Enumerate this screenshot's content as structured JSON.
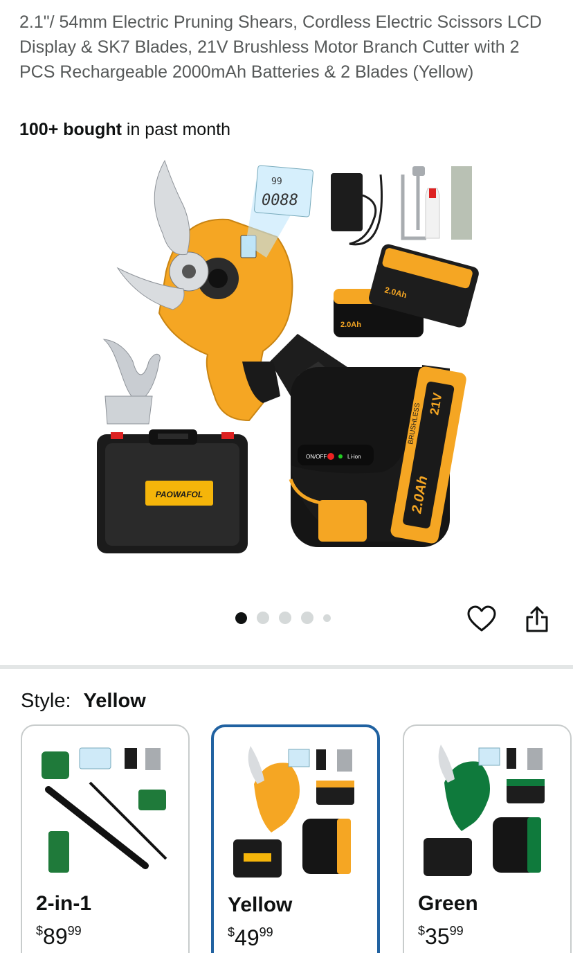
{
  "product": {
    "title": "2.1\"/ 54mm Electric Pruning Shears, Cordless Electric Scissors LCD Display & SK7 Blades, 21V Brushless Motor Branch Cutter with 2 PCS Rechargeable 2000mAh Batteries & 2 Blades (Yellow)",
    "bought_bold": "100+ bought",
    "bought_rest": " in past month"
  },
  "hero": {
    "lcd_top": "99",
    "lcd_bottom": "0088",
    "brand": "PAOWAFOL",
    "battery_label": "2.0Ah",
    "battery_volt": "21V",
    "brushless": "BRUSHLESS",
    "onoff": "ON/OFF",
    "liion": "Li-ion"
  },
  "carousel": {
    "count": 5,
    "active_index": 0
  },
  "actions": {
    "heart_icon": "heart-icon",
    "share_icon": "share-icon"
  },
  "style": {
    "label": "Style:",
    "selected": "Yellow",
    "options": [
      {
        "name": "2-in-1",
        "currency": "$",
        "dollars": "89",
        "cents": "99",
        "accent": "#1f7a3a"
      },
      {
        "name": "Yellow",
        "currency": "$",
        "dollars": "49",
        "cents": "99",
        "accent": "#f5a623"
      },
      {
        "name": "Green",
        "currency": "$",
        "dollars": "35",
        "cents": "99",
        "accent": "#0f7a3c"
      }
    ]
  },
  "colors": {
    "selected_border": "#2162a1",
    "yellow": "#f5a623",
    "black": "#1a1a1a"
  }
}
